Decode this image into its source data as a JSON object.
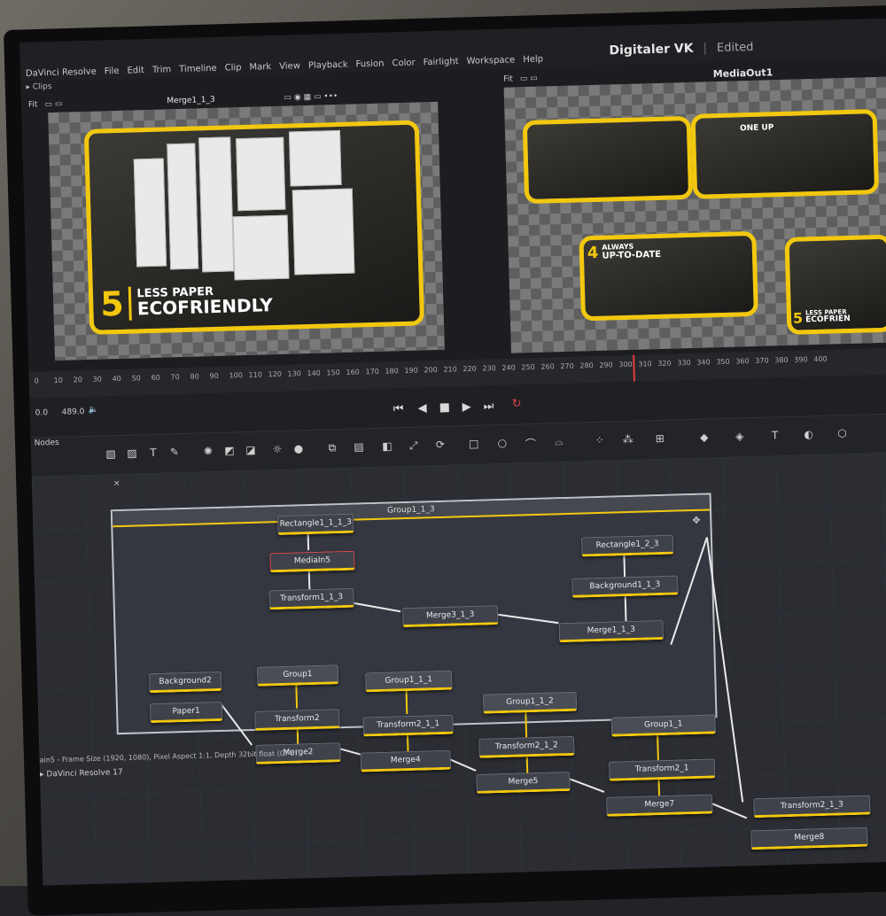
{
  "menubar": {
    "app": "DaVinci Resolve",
    "items": [
      "File",
      "Edit",
      "Trim",
      "Timeline",
      "Clip",
      "Mark",
      "View",
      "Playback",
      "Fusion",
      "Color",
      "Fairlight",
      "Workspace",
      "Help"
    ],
    "project": "Digitaler VK",
    "status": "Edited"
  },
  "viewer_left": {
    "fit": "Fit",
    "title": "Merge1_1_3",
    "clips_label": "Clips",
    "caption_num": "5",
    "caption_line1": "LESS PAPER",
    "caption_line2": "ECOFRIENDLY"
  },
  "viewer_right": {
    "fit": "Fit",
    "title": "MediaOut1",
    "card2_label": "ONE UP",
    "card3_num": "4",
    "card3_line1": "ALWAYS",
    "card3_line2": "UP-TO-DATE",
    "card4_num": "5",
    "card4_line1": "LESS PAPER",
    "card4_line2": "ECOFRIEN"
  },
  "timeline": {
    "ticks": [
      "0",
      "10",
      "20",
      "30",
      "40",
      "50",
      "60",
      "70",
      "80",
      "90",
      "100",
      "110",
      "120",
      "130",
      "140",
      "150",
      "160",
      "170",
      "180",
      "190",
      "200",
      "210",
      "220",
      "230",
      "240",
      "250",
      "260",
      "270",
      "280",
      "290",
      "300",
      "310",
      "320",
      "330",
      "340",
      "350",
      "360",
      "370",
      "380",
      "390",
      "400"
    ],
    "start": "0.0",
    "end": "489.0",
    "current_frame": 310
  },
  "transport": {
    "first": "⏮",
    "prev": "◀",
    "stop": "■",
    "play": "▶",
    "last": "⏭",
    "loop": "↻"
  },
  "nodes_panel": {
    "label": "Nodes",
    "group_title": "Group1_1_3",
    "nodes": {
      "rect1": "Rectangle1_1_1_3",
      "media": "MediaIn5",
      "transform1": "Transform1_1_3",
      "merge3": "Merge3_1_3",
      "rect2": "Rectangle1_2_3",
      "background1": "Background1_1_3",
      "merge1": "Merge1_1_3",
      "background2": "Background2",
      "paper1": "Paper1",
      "group1": "Group1",
      "transform2": "Transform2",
      "merge2": "Merge2",
      "group1_1_1": "Group1_1_1",
      "transform2_1_1": "Transform2_1_1",
      "merge4": "Merge4",
      "group1_1_2": "Group1_1_2",
      "transform2_1_2": "Transform2_1_2",
      "merge5": "Merge5",
      "group1_1": "Group1_1",
      "transform2_1": "Transform2_1",
      "merge7": "Merge7",
      "transform2_1_3": "Transform2_1_3",
      "merge8": "Merge8"
    },
    "info": "ain5 - Frame Size (1920, 1080), Pixel Aspect 1:1, Depth 32bit float (GPU)",
    "app_version": "DaVinci Resolve 17"
  }
}
